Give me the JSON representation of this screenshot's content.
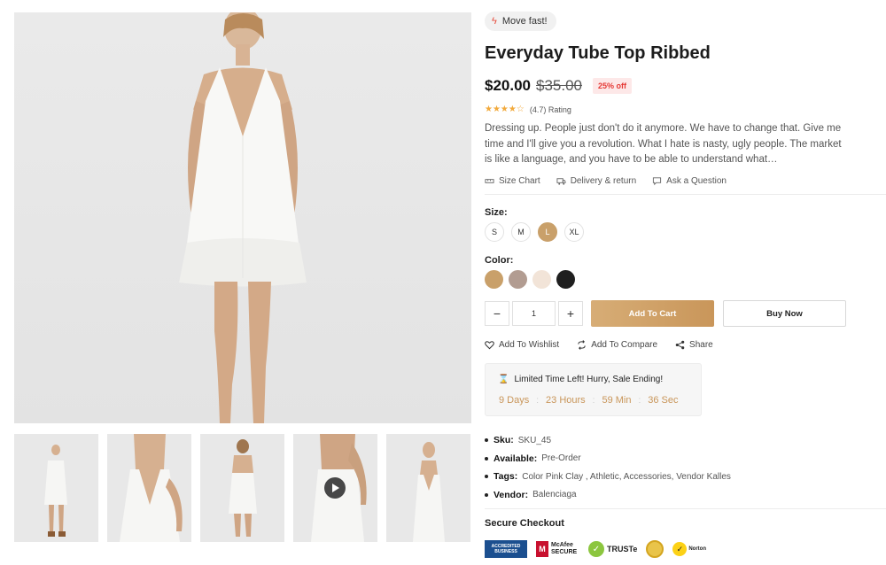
{
  "product": {
    "promo_badge": "Move fast!",
    "title": "Everyday Tube Top Ribbed",
    "price": "$20.00",
    "old_price": "$35.00",
    "discount": "25% off",
    "rating_text": "(4.7) Rating",
    "rating_value": 4.7,
    "description": "Dressing up. People just don't do it anymore. We have to change that. Give me time and I'll give you a revolution. What I hate is nasty, ugly people. The market is like a language, and you have to be able to understand what…"
  },
  "info_links": {
    "size_chart": "Size Chart",
    "delivery": "Delivery & return",
    "ask": "Ask a Question"
  },
  "size": {
    "label": "Size:",
    "options": [
      "S",
      "M",
      "L",
      "XL"
    ],
    "selected": "L"
  },
  "color": {
    "label": "Color:",
    "swatches": [
      "#c9a06a",
      "#b29c91",
      "#f2e4d8",
      "#1f1f1f"
    ]
  },
  "purchase": {
    "qty_minus": "−",
    "qty_value": "1",
    "qty_plus": "+",
    "add_to_cart": "Add To Cart",
    "buy_now": "Buy Now"
  },
  "actions": {
    "wishlist": "Add To Wishlist",
    "compare": "Add To Compare",
    "share": "Share"
  },
  "countdown": {
    "title": "Limited Time Left! Hurry, Sale Ending!",
    "days": "9 Days",
    "hours": "23 Hours",
    "minutes": "59 Min",
    "seconds": "36 Sec"
  },
  "meta": [
    {
      "key": "Sku:",
      "value": "SKU_45"
    },
    {
      "key": "Available:",
      "value": "Pre-Order"
    },
    {
      "key": "Tags:",
      "value": "Color Pink Clay , Athletic, Accessories, Vendor Kalles"
    },
    {
      "key": "Vendor:",
      "value": "Balenciaga"
    }
  ],
  "secure_checkout": {
    "title": "Secure Checkout",
    "badges": [
      "ACCREDITED BUSINESS",
      "McAfee SECURE",
      "TRUSTe",
      "Norton"
    ]
  },
  "colors": {
    "accent": "#c9965a",
    "discount_red": "#e53935",
    "star": "#f2a93b"
  }
}
